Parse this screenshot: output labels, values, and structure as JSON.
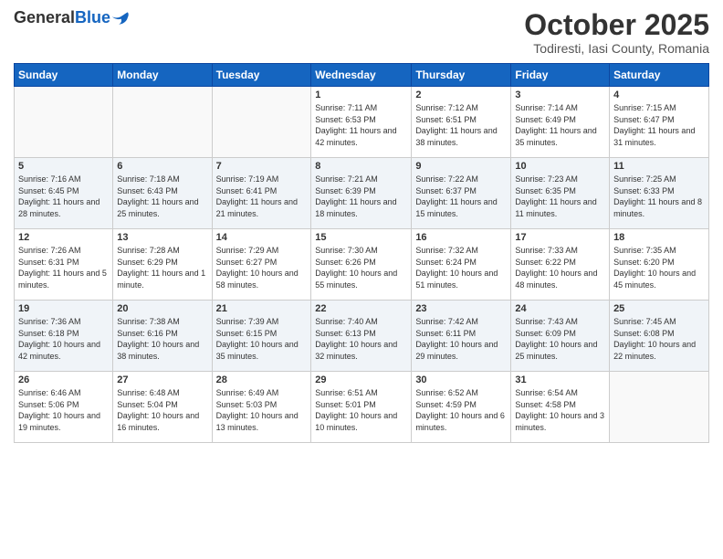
{
  "logo": {
    "general": "General",
    "blue": "Blue"
  },
  "title": "October 2025",
  "location": "Todiresti, Iasi County, Romania",
  "days_of_week": [
    "Sunday",
    "Monday",
    "Tuesday",
    "Wednesday",
    "Thursday",
    "Friday",
    "Saturday"
  ],
  "weeks": [
    [
      {
        "day": "",
        "info": ""
      },
      {
        "day": "",
        "info": ""
      },
      {
        "day": "",
        "info": ""
      },
      {
        "day": "1",
        "info": "Sunrise: 7:11 AM\nSunset: 6:53 PM\nDaylight: 11 hours and 42 minutes."
      },
      {
        "day": "2",
        "info": "Sunrise: 7:12 AM\nSunset: 6:51 PM\nDaylight: 11 hours and 38 minutes."
      },
      {
        "day": "3",
        "info": "Sunrise: 7:14 AM\nSunset: 6:49 PM\nDaylight: 11 hours and 35 minutes."
      },
      {
        "day": "4",
        "info": "Sunrise: 7:15 AM\nSunset: 6:47 PM\nDaylight: 11 hours and 31 minutes."
      }
    ],
    [
      {
        "day": "5",
        "info": "Sunrise: 7:16 AM\nSunset: 6:45 PM\nDaylight: 11 hours and 28 minutes."
      },
      {
        "day": "6",
        "info": "Sunrise: 7:18 AM\nSunset: 6:43 PM\nDaylight: 11 hours and 25 minutes."
      },
      {
        "day": "7",
        "info": "Sunrise: 7:19 AM\nSunset: 6:41 PM\nDaylight: 11 hours and 21 minutes."
      },
      {
        "day": "8",
        "info": "Sunrise: 7:21 AM\nSunset: 6:39 PM\nDaylight: 11 hours and 18 minutes."
      },
      {
        "day": "9",
        "info": "Sunrise: 7:22 AM\nSunset: 6:37 PM\nDaylight: 11 hours and 15 minutes."
      },
      {
        "day": "10",
        "info": "Sunrise: 7:23 AM\nSunset: 6:35 PM\nDaylight: 11 hours and 11 minutes."
      },
      {
        "day": "11",
        "info": "Sunrise: 7:25 AM\nSunset: 6:33 PM\nDaylight: 11 hours and 8 minutes."
      }
    ],
    [
      {
        "day": "12",
        "info": "Sunrise: 7:26 AM\nSunset: 6:31 PM\nDaylight: 11 hours and 5 minutes."
      },
      {
        "day": "13",
        "info": "Sunrise: 7:28 AM\nSunset: 6:29 PM\nDaylight: 11 hours and 1 minute."
      },
      {
        "day": "14",
        "info": "Sunrise: 7:29 AM\nSunset: 6:27 PM\nDaylight: 10 hours and 58 minutes."
      },
      {
        "day": "15",
        "info": "Sunrise: 7:30 AM\nSunset: 6:26 PM\nDaylight: 10 hours and 55 minutes."
      },
      {
        "day": "16",
        "info": "Sunrise: 7:32 AM\nSunset: 6:24 PM\nDaylight: 10 hours and 51 minutes."
      },
      {
        "day": "17",
        "info": "Sunrise: 7:33 AM\nSunset: 6:22 PM\nDaylight: 10 hours and 48 minutes."
      },
      {
        "day": "18",
        "info": "Sunrise: 7:35 AM\nSunset: 6:20 PM\nDaylight: 10 hours and 45 minutes."
      }
    ],
    [
      {
        "day": "19",
        "info": "Sunrise: 7:36 AM\nSunset: 6:18 PM\nDaylight: 10 hours and 42 minutes."
      },
      {
        "day": "20",
        "info": "Sunrise: 7:38 AM\nSunset: 6:16 PM\nDaylight: 10 hours and 38 minutes."
      },
      {
        "day": "21",
        "info": "Sunrise: 7:39 AM\nSunset: 6:15 PM\nDaylight: 10 hours and 35 minutes."
      },
      {
        "day": "22",
        "info": "Sunrise: 7:40 AM\nSunset: 6:13 PM\nDaylight: 10 hours and 32 minutes."
      },
      {
        "day": "23",
        "info": "Sunrise: 7:42 AM\nSunset: 6:11 PM\nDaylight: 10 hours and 29 minutes."
      },
      {
        "day": "24",
        "info": "Sunrise: 7:43 AM\nSunset: 6:09 PM\nDaylight: 10 hours and 25 minutes."
      },
      {
        "day": "25",
        "info": "Sunrise: 7:45 AM\nSunset: 6:08 PM\nDaylight: 10 hours and 22 minutes."
      }
    ],
    [
      {
        "day": "26",
        "info": "Sunrise: 6:46 AM\nSunset: 5:06 PM\nDaylight: 10 hours and 19 minutes."
      },
      {
        "day": "27",
        "info": "Sunrise: 6:48 AM\nSunset: 5:04 PM\nDaylight: 10 hours and 16 minutes."
      },
      {
        "day": "28",
        "info": "Sunrise: 6:49 AM\nSunset: 5:03 PM\nDaylight: 10 hours and 13 minutes."
      },
      {
        "day": "29",
        "info": "Sunrise: 6:51 AM\nSunset: 5:01 PM\nDaylight: 10 hours and 10 minutes."
      },
      {
        "day": "30",
        "info": "Sunrise: 6:52 AM\nSunset: 4:59 PM\nDaylight: 10 hours and 6 minutes."
      },
      {
        "day": "31",
        "info": "Sunrise: 6:54 AM\nSunset: 4:58 PM\nDaylight: 10 hours and 3 minutes."
      },
      {
        "day": "",
        "info": ""
      }
    ]
  ]
}
